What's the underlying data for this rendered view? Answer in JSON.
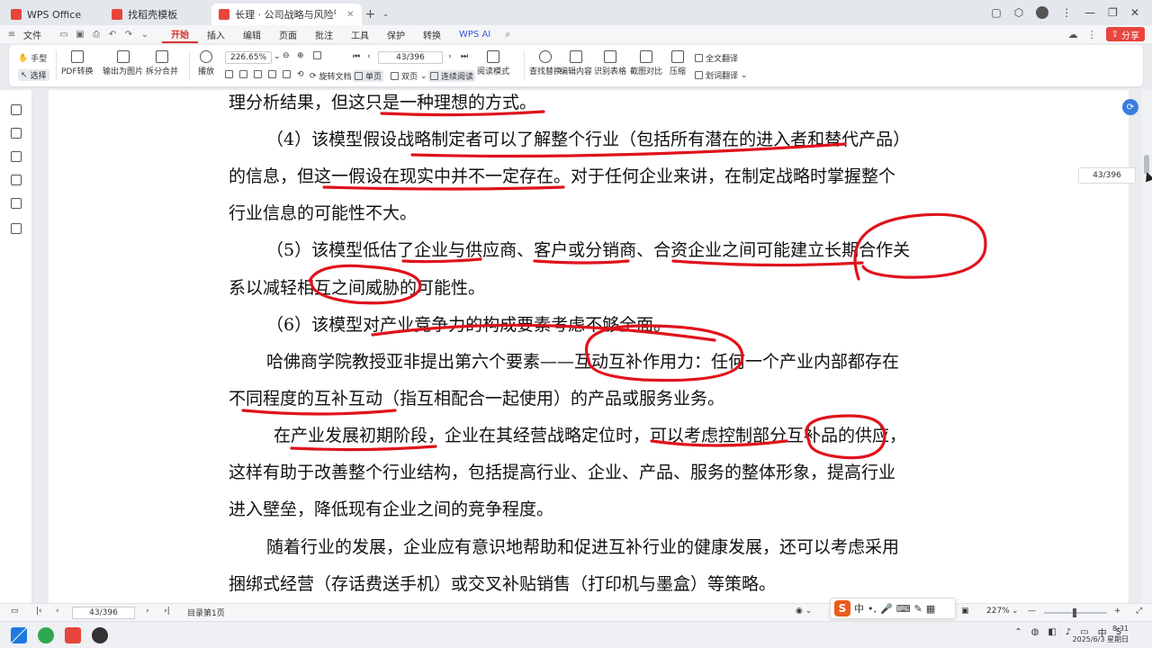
{
  "titlebar": {
    "tabs": [
      {
        "label": "WPS Office",
        "color": "#e8453c",
        "active": false
      },
      {
        "label": "找稻壳模板",
        "color": "#e8453c",
        "active": false
      },
      {
        "label": "长理 · 公司战略与风险管理",
        "color": "#e8453c",
        "active": true
      }
    ],
    "add": "+",
    "more": "⌄"
  },
  "menubar": {
    "file": "文件",
    "items": [
      "开始",
      "插入",
      "编辑",
      "页面",
      "批注",
      "工具",
      "保护",
      "转换",
      "WPS AI"
    ],
    "active_index": 0,
    "share": "分享"
  },
  "toolbar": {
    "hand": "手型",
    "select": "选择",
    "pdf_convert": "PDF转换",
    "export_image": "输出为图片",
    "split_merge": "拆分合并",
    "play": "播放",
    "zoom_value": "226.65%",
    "page_value": "43/396",
    "rotate": "旋转文档",
    "single": "单页",
    "double": "双页",
    "continuous": "连续阅读",
    "read_mode": "阅读模式",
    "find_replace": "查找替换",
    "edit_content": "编辑内容",
    "recognize_table": "识别表格",
    "compare": "截图对比",
    "compress": "压缩",
    "full_translate": "全文翻译",
    "word_translate": "划词翻译"
  },
  "document": {
    "paragraphs": [
      "理分析结果，但这只是一种理想的方式。",
      "（4）该模型假设战略制定者可以了解整个行业（包括所有潜在的进入者和替代产品）",
      "的信息，但这一假设在现实中并不一定存在。对于任何企业来讲，在制定战略时掌握整个",
      "行业信息的可能性不大。",
      "（5）该模型低估了企业与供应商、客户或分销商、合资企业之间可能建立长期合作关",
      "系以减轻相互之间威胁的可能性。",
      "（6）该模型对产业竞争力的构成要素考虑不够全面。",
      "哈佛商学院教授亚非提出第六个要素——互动互补作用力：任何一个产业内部都存在",
      "不同程度的互补互动（指互相配合一起使用）的产品或服务业务。",
      "在产业发展初期阶段，企业在其经营战略定位时，可以考虑控制部分互补品的供应，",
      "这样有助于改善整个行业结构，包括提高行业、企业、产品、服务的整体形象，提高行业",
      "进入壁垒，降低现有企业之间的竞争程度。",
      "随着行业的发展，企业应有意识地帮助和促进互补行业的健康发展，还可以考虑采用",
      "捆绑式经营（存话费送手机）或交叉补贴销售（打印机与墨盒）等策略。"
    ],
    "ink_color": "#e0121b",
    "page_tip": "43/396"
  },
  "statusbar": {
    "page_value": "43/396",
    "section": "目录第1页",
    "zoom": "227%"
  },
  "ime": {
    "logo": "S",
    "mode": "中"
  },
  "taskbar": {
    "time": "8:31",
    "date": "2025/6/3 星期日"
  }
}
